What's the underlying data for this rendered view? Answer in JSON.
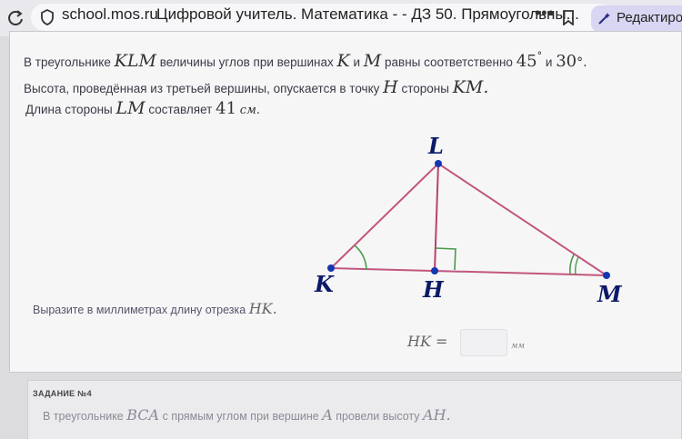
{
  "browser": {
    "domain": "school.mos.ru",
    "page_title": "Цифровой учитель. Математика - - ДЗ 50. Прямоугольны...",
    "menu_dots": "•••",
    "edit_label": "Редактиров"
  },
  "task": {
    "line1": {
      "t1": "В треугольнике",
      "v1": "KLM",
      "t2": "величины углов при вершинах",
      "v2": "K",
      "t3": "и",
      "v3": "M",
      "t4": "равны соответственно",
      "n1": "45",
      "deg1": "°",
      "t5": "и",
      "n2": "30",
      "deg2": "°."
    },
    "line2": {
      "t1": "Высота, проведённая из третьей вершины, опускается в точку",
      "v1": "H",
      "t2": "стороны",
      "v2": "KM."
    },
    "line3": {
      "t1": "Длина стороны",
      "v1": "LM",
      "t2": "составляет",
      "n1": "41",
      "unit": "см."
    },
    "figure": {
      "labels": {
        "L": "L",
        "K": "K",
        "H": "H",
        "M": "M"
      },
      "colors": {
        "sides": "#c2567e",
        "height": "#b8436d",
        "points": "#1437b0",
        "marks": "#4a9a4a"
      }
    },
    "question": {
      "text": "Выразите в миллиметрах длину отрезка",
      "var": "HK."
    },
    "answer": {
      "name": "HK =",
      "value": "",
      "unit": "мм"
    }
  },
  "next_task": {
    "number": "ЗАДАНИЕ №4",
    "t1": "В треугольнике",
    "v1": "BCA",
    "t2": "с прямым углом при вершине",
    "v2": "A",
    "t3": "провели высоту",
    "v3": "AH."
  }
}
